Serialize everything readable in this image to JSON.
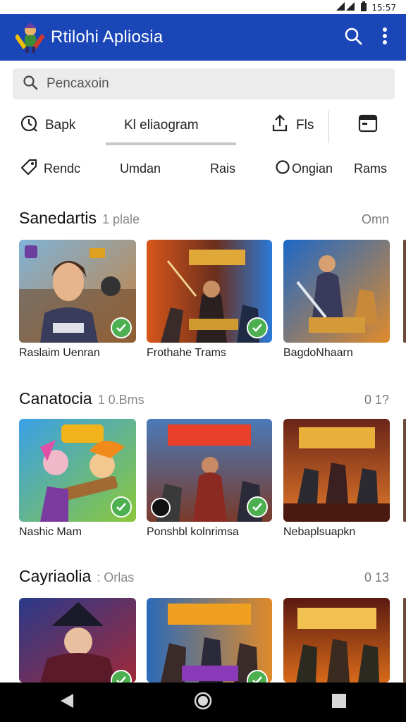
{
  "status_bar": {
    "time": "15:57"
  },
  "app": {
    "title": "Rtilohi Apliosia"
  },
  "search": {
    "placeholder": "Pencaxoin"
  },
  "tabs": [
    {
      "label": "Bapk"
    },
    {
      "label": "Kl eliaogram"
    },
    {
      "label": "Fls"
    }
  ],
  "chips": [
    {
      "label": "Rendc"
    },
    {
      "label": "Umdan"
    },
    {
      "label": "Rais"
    },
    {
      "label": "Ongian"
    },
    {
      "label": "Rams"
    }
  ],
  "sections": [
    {
      "title": "Sanedartis",
      "subtitle": "1 plale",
      "more": "Omn",
      "items": [
        {
          "label": "Raslaim Uenran",
          "badge": "check",
          "art": "hero-girl"
        },
        {
          "label": "Frothahe Trams",
          "badge": "check",
          "art": "battle-orange"
        },
        {
          "label": "BagdoNhaarn",
          "badge": "none",
          "art": "battle-blue"
        }
      ]
    },
    {
      "title": "Canatocia",
      "subtitle": "1 0.Bms",
      "more": "0 1?",
      "items": [
        {
          "label": "Nashic Mam",
          "badge": "check",
          "art": "cartoon"
        },
        {
          "label": "Ponshbl kolnrimsa",
          "badge": "check",
          "art": "warriors"
        },
        {
          "label": "Nebaplsuapkn",
          "badge": "none",
          "art": "army"
        }
      ]
    },
    {
      "title": "Cayriaolia",
      "subtitle": ": Orlas",
      "more": "0 13",
      "items": [
        {
          "label": "",
          "badge": "check",
          "art": "dark-hero"
        },
        {
          "label": "",
          "badge": "check",
          "art": "squad"
        },
        {
          "label": "",
          "badge": "none",
          "art": "fire-army"
        }
      ]
    }
  ],
  "colors": {
    "app_bar": "#1a46b8",
    "badge": "#4caf50"
  }
}
